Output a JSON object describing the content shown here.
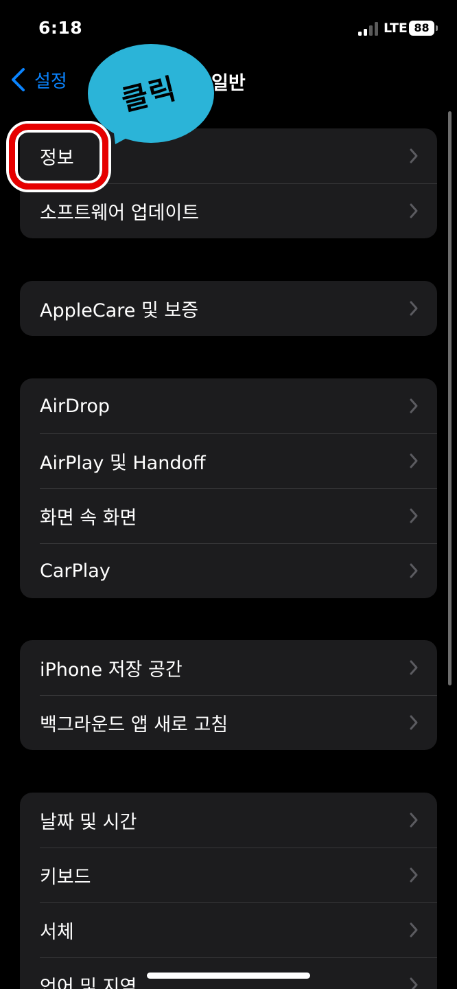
{
  "status": {
    "time": "6:18",
    "network": "LTE",
    "battery": "88"
  },
  "nav": {
    "back_label": "설정",
    "title": "일반"
  },
  "annotation": {
    "bubble_text": "클릭"
  },
  "groups": [
    {
      "rows": [
        {
          "label": "정보"
        },
        {
          "label": "소프트웨어 업데이트"
        }
      ]
    },
    {
      "rows": [
        {
          "label": "AppleCare 및 보증"
        }
      ]
    },
    {
      "rows": [
        {
          "label": "AirDrop"
        },
        {
          "label": "AirPlay 및 Handoff"
        },
        {
          "label": "화면 속 화면"
        },
        {
          "label": "CarPlay"
        }
      ]
    },
    {
      "rows": [
        {
          "label": "iPhone 저장 공간"
        },
        {
          "label": "백그라운드 앱 새로 고침"
        }
      ]
    },
    {
      "rows": [
        {
          "label": "날짜 및 시간"
        },
        {
          "label": "키보드"
        },
        {
          "label": "서체"
        },
        {
          "label": "언어 및 지역"
        }
      ]
    }
  ],
  "colors": {
    "accent": "#0a84ff",
    "highlight": "#e60000",
    "bubble": "#2bb4d8",
    "cell": "#1c1c1e"
  },
  "icons": {
    "back": "chevron-left-icon",
    "row_disclosure": "chevron-right-icon",
    "signal": "cellular-signal-icon",
    "battery": "battery-icon"
  }
}
